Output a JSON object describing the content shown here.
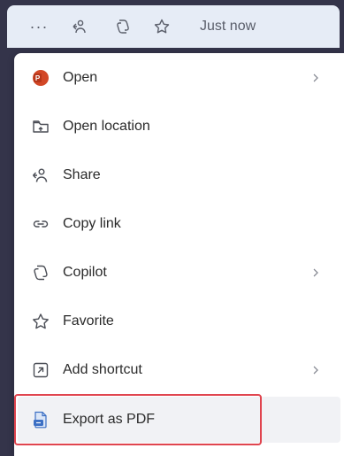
{
  "toolbar": {
    "more_label": "···",
    "time_label": "Just now"
  },
  "menu": {
    "items": [
      {
        "label": "Open",
        "icon": "powerpoint-icon",
        "has_submenu": true
      },
      {
        "label": "Open location",
        "icon": "folder-icon",
        "has_submenu": false
      },
      {
        "label": "Share",
        "icon": "share-icon",
        "has_submenu": false
      },
      {
        "label": "Copy link",
        "icon": "link-icon",
        "has_submenu": false
      },
      {
        "label": "Copilot",
        "icon": "copilot-icon",
        "has_submenu": true
      },
      {
        "label": "Favorite",
        "icon": "star-icon",
        "has_submenu": false
      },
      {
        "label": "Add shortcut",
        "icon": "shortcut-icon",
        "has_submenu": true
      },
      {
        "label": "Export as PDF",
        "icon": "pdf-export-icon",
        "has_submenu": false,
        "highlighted": true
      }
    ]
  },
  "colors": {
    "highlight_border": "#e0454f",
    "powerpoint": "#d24726",
    "pdf_icon": "#3b6fc4"
  }
}
